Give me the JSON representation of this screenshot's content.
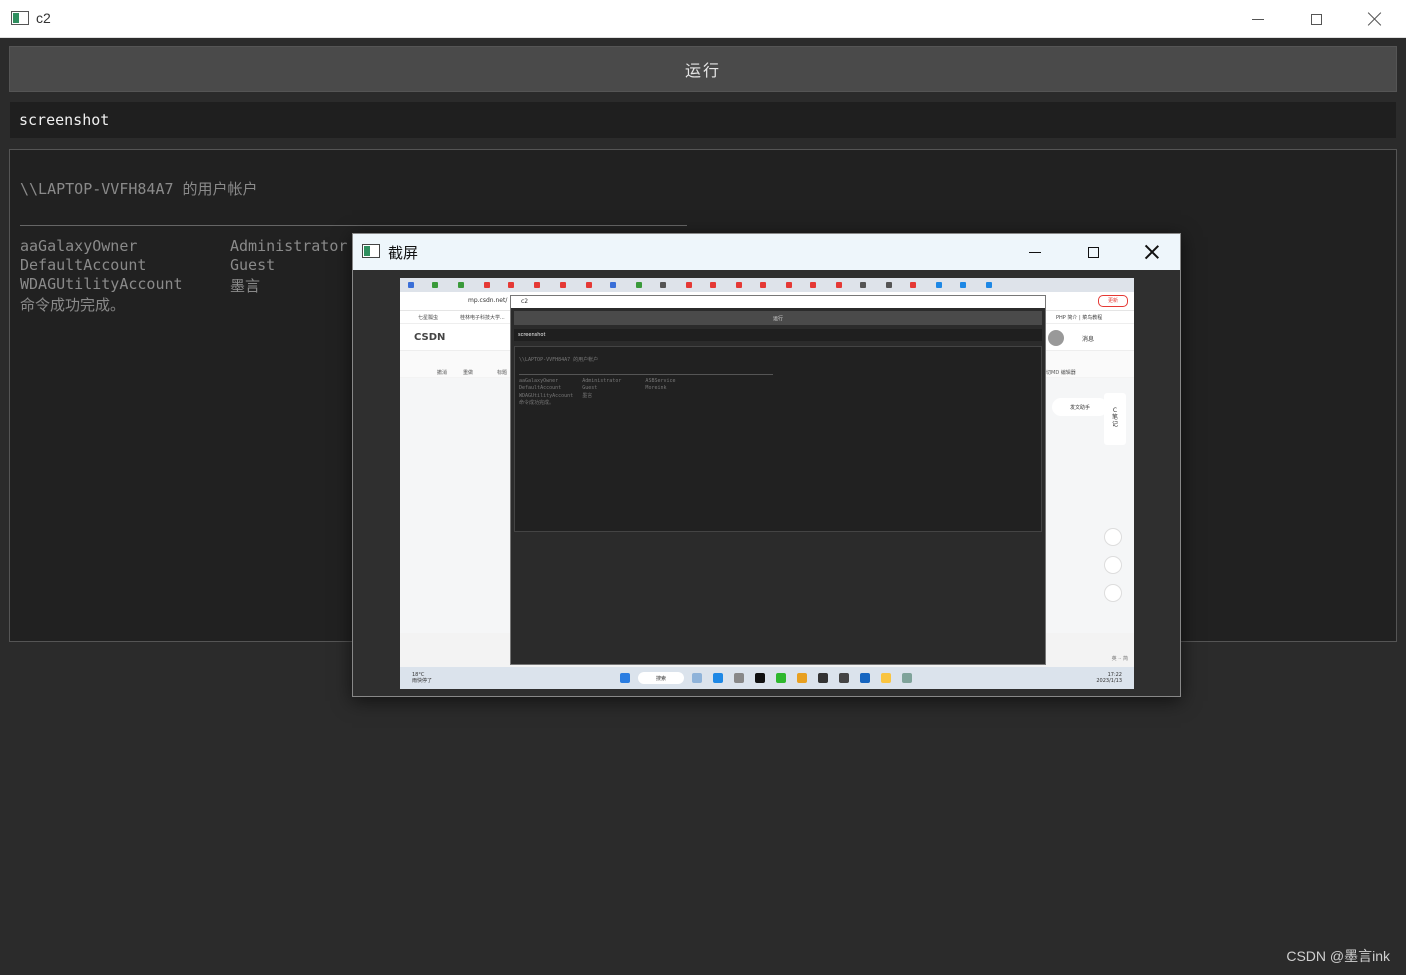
{
  "window": {
    "title": "c2"
  },
  "run_button": {
    "label": "运行"
  },
  "command": {
    "value": "screenshot"
  },
  "output": {
    "header": "\\\\LAPTOP-VVFH84A7 的用户帐户",
    "rule": "-------------------------------------------------------------------------------",
    "accounts": [
      {
        "col1": "aaGalaxyOwner",
        "col2": "Administrator"
      },
      {
        "col1": "DefaultAccount",
        "col2": "Guest"
      },
      {
        "col1": "WDAGUtilityAccount",
        "col2": "墨言"
      }
    ],
    "completion": "命令成功完成。"
  },
  "dialog": {
    "title": "截屏"
  },
  "screenshot": {
    "address": "mp.csdn.net/",
    "inner_tab": "c2",
    "bookmarks": [
      "七星瓢虫",
      "桂林电子科技大学..."
    ],
    "bookmarks_right": "PHP 简介 | 菜鸟教程",
    "csdn_logo": "CSDN",
    "csdn_messages": "消息",
    "csdn_update": "更新",
    "toolbar_items": [
      "撤消",
      "重做",
      "标题"
    ],
    "md_editor": "切MD 编辑器",
    "helper": "发文助手",
    "side_note": "C 笔 记",
    "input_method": "英 ·· 简",
    "inner_window": {
      "title": "c2",
      "run": "运行",
      "cmd": "screenshot",
      "header": "\\\\LAPTOP-VVFH84A7 的用户帐户",
      "row1": "aaGalaxyOwner        Administrator        ASBService",
      "row2": "DefaultAccount       Guest                Moreink",
      "row3": "WDAGUtilityAccount   墨言",
      "done": "命令成功完成。"
    },
    "taskbar": {
      "weather_temp": "18°C",
      "weather_desc": "雨快停了",
      "search": "搜索",
      "time": "17:22",
      "date": "2023/1/13"
    }
  },
  "watermark": "CSDN @墨言ink"
}
